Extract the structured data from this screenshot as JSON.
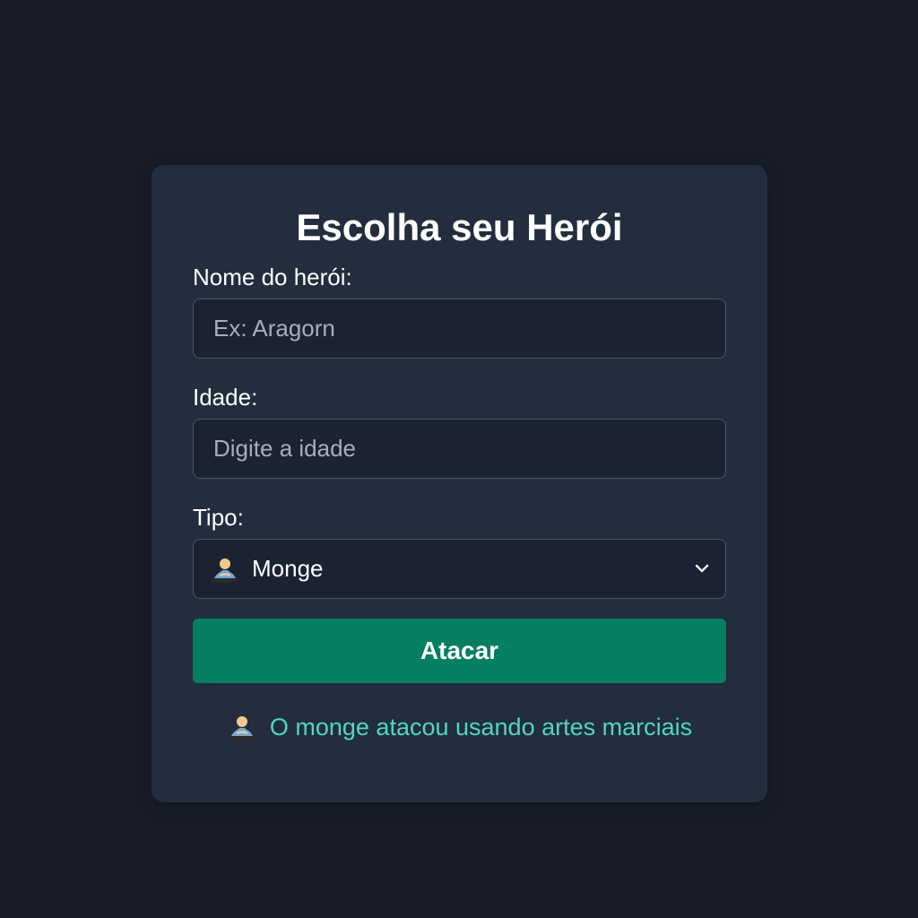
{
  "form": {
    "title": "Escolha seu Herói",
    "name_label": "Nome do herói:",
    "name_placeholder": "Ex: Aragorn",
    "name_value": "",
    "age_label": "Idade:",
    "age_placeholder": "Digite a idade",
    "age_value": "",
    "type_label": "Tipo:",
    "type_selected": "Monge",
    "type_icon": "monk-icon",
    "submit_label": "Atacar"
  },
  "result": {
    "icon": "monk-icon",
    "message": "O monge atacou usando artes marciais"
  },
  "colors": {
    "background": "#171c28",
    "card": "#232d3d",
    "input_bg": "#1b2232",
    "accent_button": "#047f62",
    "result_text": "#4ed6c4"
  }
}
